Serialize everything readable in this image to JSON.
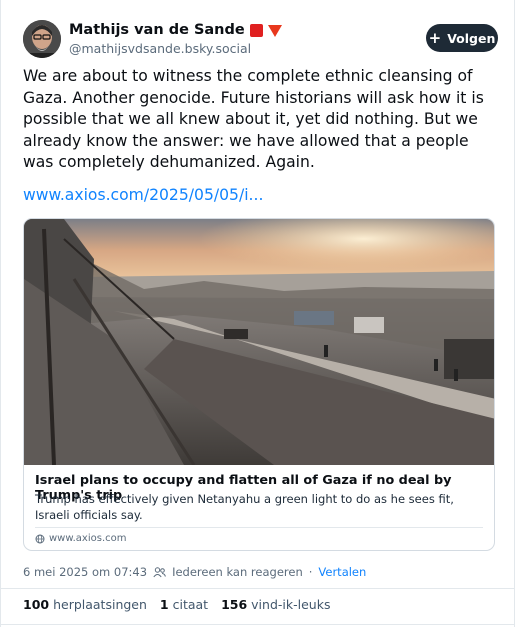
{
  "author": {
    "display_name": "Mathijs van de Sande",
    "handle": "@mathijsvdsande.bsky.social",
    "avatar_icon": "bearded-man-avatar",
    "badges": [
      "red-square",
      "red-down-triangle"
    ]
  },
  "follow_button": {
    "label": "Volgen",
    "icon": "plus-icon"
  },
  "post": {
    "text": "We are about to witness the complete ethnic cleansing of Gaza. Another genocide. Future historians will ask how it is possible that we all knew about it, yet did nothing. But we already know the answer: we have allowed that a people was completely dehumanized. Again.",
    "link_text": "www.axios.com/2025/05/05/i..."
  },
  "link_card": {
    "title": "Israel plans to occupy and flatten all of Gaza if no deal by Trump's trip",
    "description": "Trump has effectively given Netanyahu a green light to do as he sees fit, Israeli officials say.",
    "domain": "www.axios.com"
  },
  "meta": {
    "timestamp": "6 mei 2025 om 07:43",
    "reply_setting": "Iedereen kan reageren",
    "separator": "·",
    "translate": "Vertalen"
  },
  "stats": {
    "reposts_count": "100",
    "reposts_label": "herplaatsingen",
    "quotes_count": "1",
    "quotes_label": "citaat",
    "likes_count": "156",
    "likes_label": "vind-ik-leuks"
  },
  "colors": {
    "accent_link": "#1083fe",
    "follow_button_bg": "#1e2a36",
    "muted_text": "#5b6b7b"
  }
}
